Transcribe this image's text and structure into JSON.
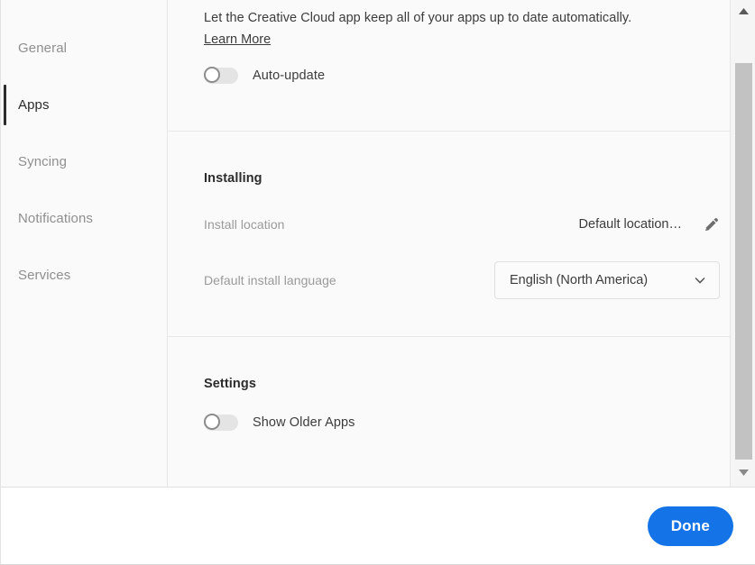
{
  "sidebar": {
    "items": [
      {
        "label": "General",
        "active": false
      },
      {
        "label": "Apps",
        "active": true
      },
      {
        "label": "Syncing",
        "active": false
      },
      {
        "label": "Notifications",
        "active": false
      },
      {
        "label": "Services",
        "active": false
      }
    ]
  },
  "content": {
    "auto_update": {
      "description": "Let the Creative Cloud app keep all of your apps up to date automatically.",
      "learn_more": "Learn More",
      "toggle_label": "Auto-update",
      "toggle_state": "off"
    },
    "installing": {
      "title": "Installing",
      "install_location_label": "Install location",
      "install_location_value": "Default location…",
      "edit_icon": "pencil-icon",
      "language_label": "Default install language",
      "language_value": "English (North America)",
      "caret_icon": "chevron-down-icon"
    },
    "settings": {
      "title": "Settings",
      "toggle_label": "Show Older Apps",
      "toggle_state": "off"
    }
  },
  "scrollbar": {
    "up_icon": "caret-up-icon",
    "down_icon": "caret-down-icon"
  },
  "footer": {
    "done_label": "Done"
  },
  "colors": {
    "accent": "#1473e6",
    "panel_bg": "#fafafa",
    "footer_bg": "#ffffff",
    "text_primary": "#3c3c3c",
    "text_muted": "#9a9a9a",
    "active_indicator": "#2c2c2c",
    "scroll_thumb": "#c2c2c2"
  }
}
